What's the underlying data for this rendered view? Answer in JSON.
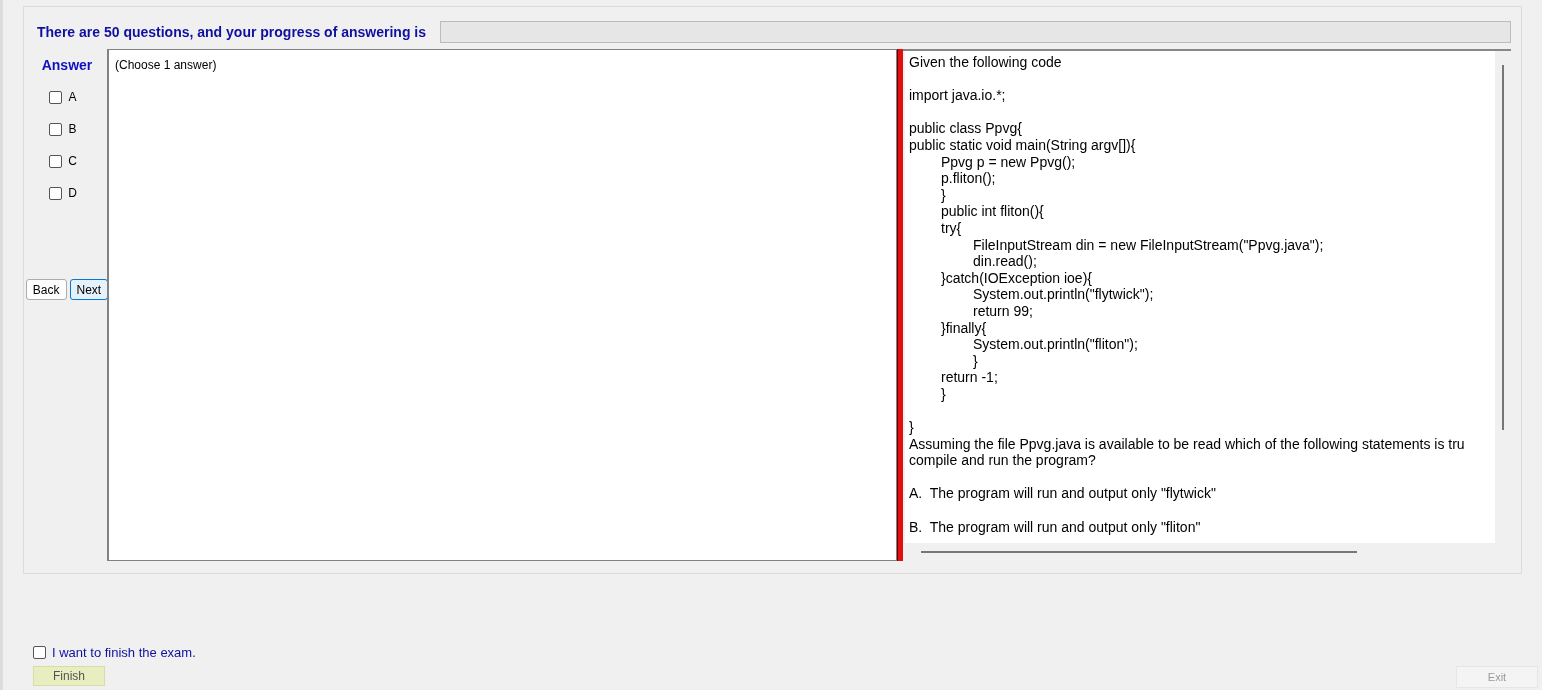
{
  "header": {
    "text": "There are 50 questions, and your progress of answering is",
    "progress": {
      "level": 0
    }
  },
  "answer_panel": {
    "title": "Answer",
    "options": [
      {
        "label": "A",
        "checked": false
      },
      {
        "label": "B",
        "checked": false
      },
      {
        "label": "C",
        "checked": false
      },
      {
        "label": "D",
        "checked": false
      }
    ],
    "buttons": [
      {
        "label": "Back",
        "selected": false
      },
      {
        "label": "Next",
        "selected": true
      }
    ]
  },
  "answer_area": {
    "hint": "(Choose 1 answer)"
  },
  "question": {
    "paragraphs": [
      [
        "Given the following code"
      ],
      [
        "import java.io.*;"
      ],
      [
        "public class Ppvg{",
        "public static void main(String argv[]){",
        "\tPpvg p = new Ppvg();",
        "\tp.fliton();",
        "\t}",
        "\tpublic int fliton(){",
        "\ttry{",
        "\t\tFileInputStream din = new FileInputStream(\"Ppvg.java\");",
        "\t\tdin.read();",
        "\t}catch(IOException ioe){",
        "\t\tSystem.out.println(\"flytwick\");",
        "\t\treturn 99;",
        "\t}finally{",
        "\t\tSystem.out.println(\"fliton\");",
        "\t\t}",
        "\treturn -1;",
        "\t}"
      ],
      [
        "}",
        "Assuming the file Ppvg.java is available to be read which of the following statements is tru",
        "compile and run the program?"
      ],
      [
        "A.  The program will run and output only \"flytwick\""
      ],
      [
        "B.  The program will run and output only \"fliton\""
      ]
    ]
  },
  "finish": {
    "label": "I want to finish the exam.",
    "checked": false,
    "button": "Finish"
  },
  "exit": {
    "label": "Exit",
    "disabled": true
  }
}
